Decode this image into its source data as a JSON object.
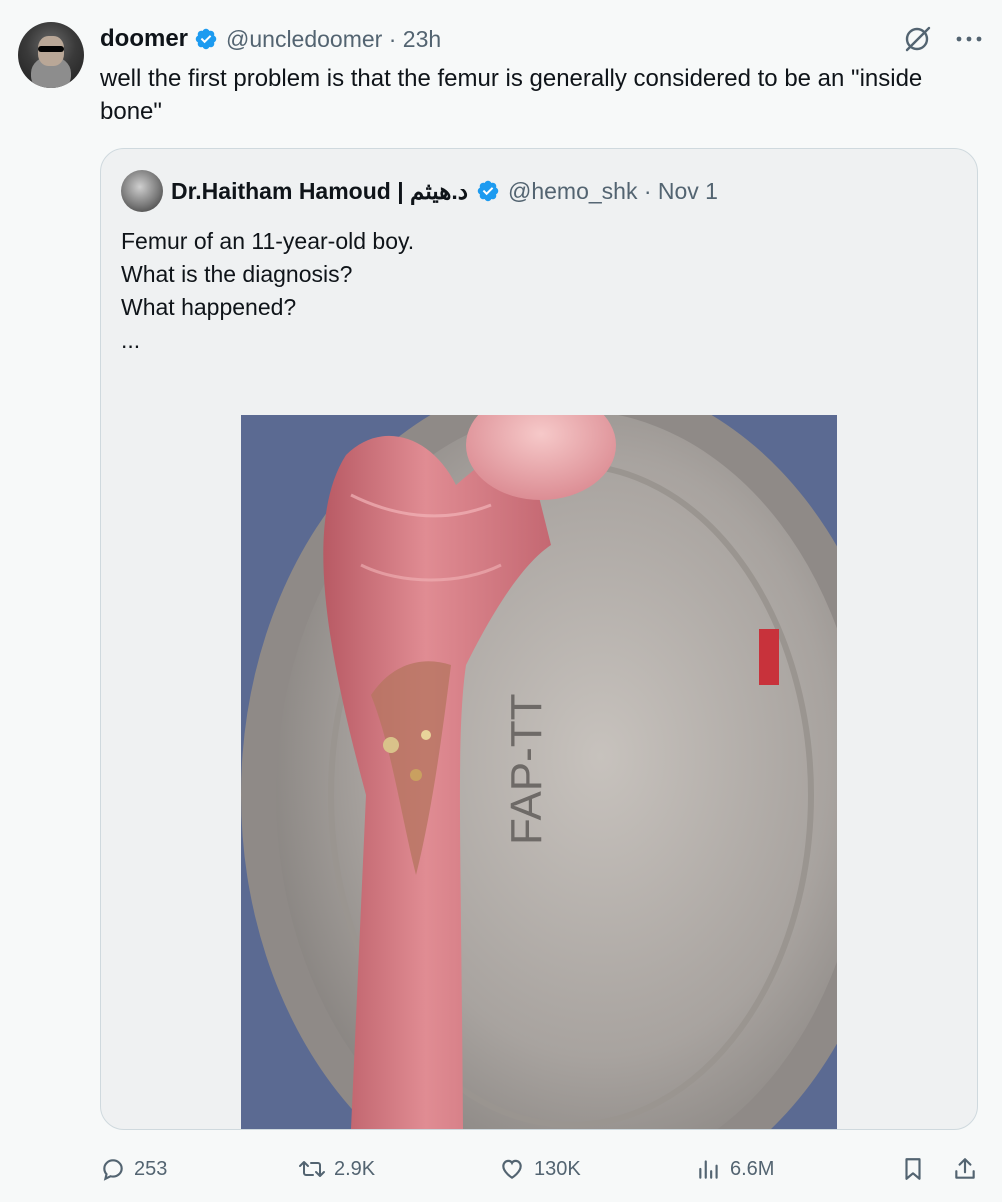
{
  "tweet": {
    "author_name": "doomer",
    "handle_time": "@uncledoomer · 23h",
    "text": "well the first problem is that the femur is generally considered to be an \"inside bone\""
  },
  "quoted_tweet": {
    "author_name": "Dr.Haitham Hamoud | د.هيثم",
    "handle_time": "@hemo_shk · Nov 1",
    "lines": [
      "Femur of an 11-year-old boy.",
      "",
      "What is the diagnosis?",
      "What happened?",
      "..."
    ],
    "photo_label": "FAP-TT"
  },
  "metrics": {
    "replies": "253",
    "reposts": "2.9K",
    "likes": "130K",
    "views": "6.6M"
  },
  "colors": {
    "verified": "#1d9bf0",
    "secondary_text": "#536471"
  }
}
